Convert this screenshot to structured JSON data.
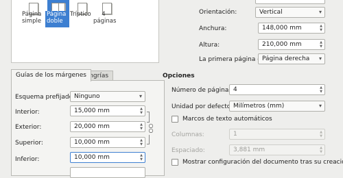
{
  "layouts": [
    {
      "label": "Página simple",
      "selected": false
    },
    {
      "label": "Página doble",
      "selected": true
    },
    {
      "label": "Tríptico",
      "selected": false
    },
    {
      "label": "4 páginas",
      "selected": false
    }
  ],
  "page_settings": {
    "orientation_label": "Orientación:",
    "orientation_value": "Vertical",
    "width_label": "Anchura:",
    "width_value": "148,000 mm",
    "height_label": "Altura:",
    "height_value": "210,000 mm",
    "first_page_label": "La primera página es:",
    "first_page_value": "Página derecha"
  },
  "tabs": {
    "margin_guides": "Guías de los márgenes",
    "bleeds": "Sangrías"
  },
  "margins": {
    "preset_label": "Esquema prefijado:",
    "preset_value": "Ninguno",
    "inner_label": "Interior:",
    "inner_value": "15,000 mm",
    "outer_label": "Exterior:",
    "outer_value": "20,000 mm",
    "top_label": "Superior:",
    "top_value": "10,000 mm",
    "bottom_label": "Inferior:",
    "bottom_value": "10,000 mm"
  },
  "options": {
    "title": "Opciones",
    "pages_label": "Número de páginas:",
    "pages_value": "4",
    "unit_label": "Unidad por defecto:",
    "unit_value": "Milímetros (mm)",
    "auto_frames_label": "Marcos de texto automáticos",
    "columns_label": "Columnas:",
    "columns_value": "1",
    "spacing_label": "Espaciado:",
    "spacing_value": "3,881 mm",
    "show_settings_label": "Mostrar configuración del documento tras su creación"
  },
  "icons": {
    "spin_arrows": "up-down-arrows",
    "combo_arrow": "chevron-down-icon",
    "chain": "chain-link-icon"
  },
  "colors": {
    "selection": "#3d7fd1",
    "window_bg": "#eeeeec",
    "panel_bg": "#ffffff"
  }
}
